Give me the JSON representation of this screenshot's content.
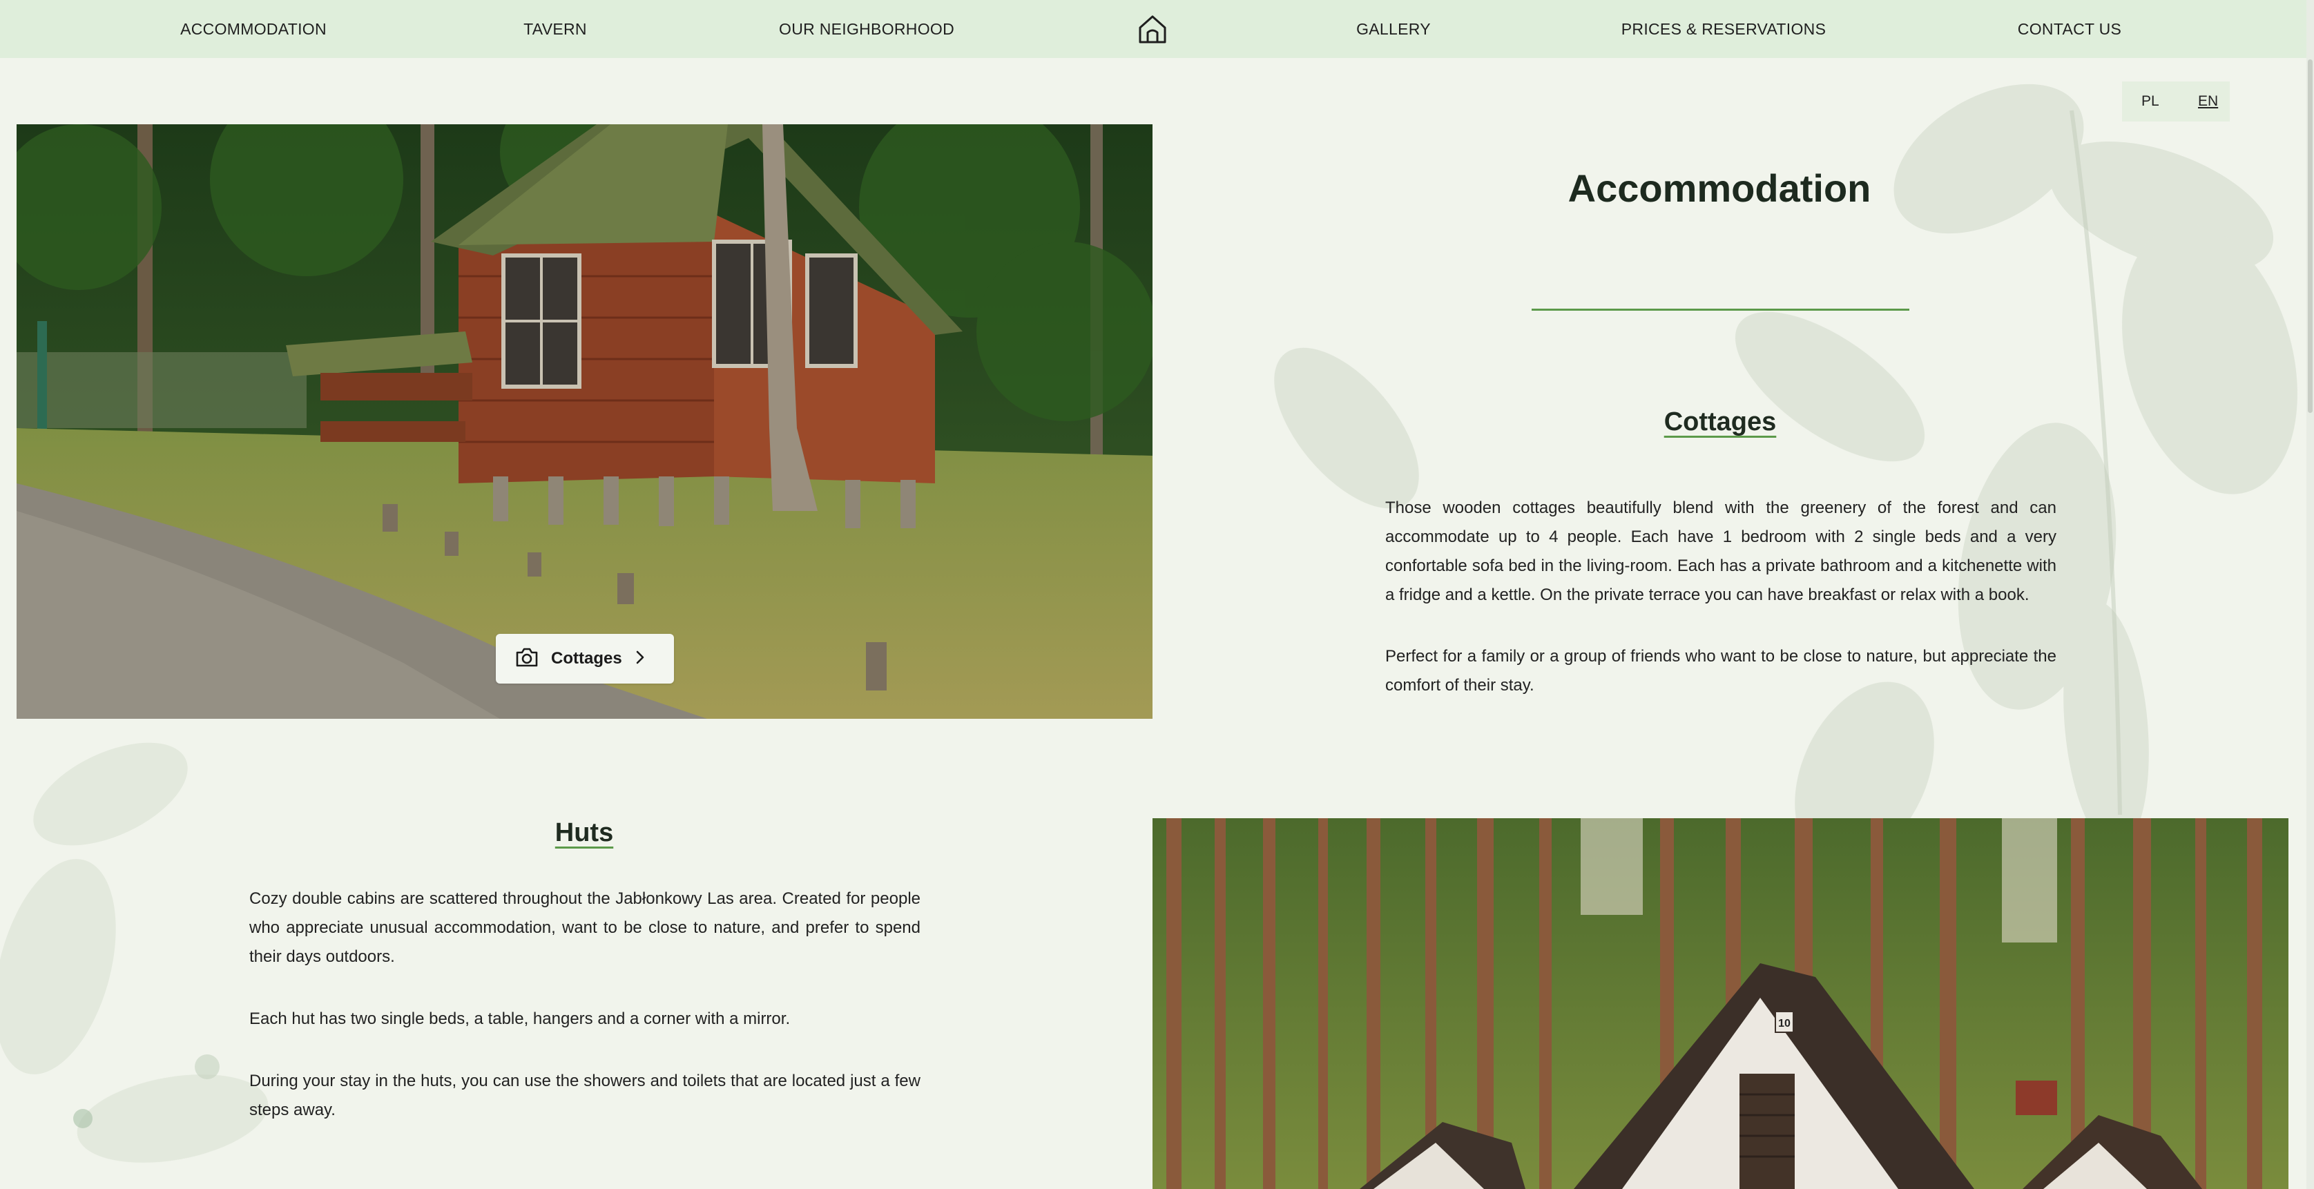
{
  "nav": {
    "items": [
      {
        "label": "ACCOMMODATION"
      },
      {
        "label": "TAVERN"
      },
      {
        "label": "OUR NEIGHBORHOOD"
      },
      {
        "label": "GALLERY"
      },
      {
        "label": "PRICES & RESERVATIONS"
      },
      {
        "label": "CONTACT US"
      }
    ],
    "home_icon": "home-icon"
  },
  "lang": {
    "pl": "PL",
    "en": "EN",
    "active": "EN"
  },
  "accommodation": {
    "title": "Accommodation",
    "cottages": {
      "heading": "Cottages",
      "gallery_button": "Cottages",
      "paragraphs": [
        "Those wooden cottages beautifully blend with the greenery of the forest and can accommodate up to 4 people. Each have 1 bedroom with 2 single beds and a very confortable sofa bed in the living-room. Each has a private bathroom and a kitchenette with a fridge and a kettle. On the private terrace you can have breakfast or relax with a book.",
        "Perfect for a family or a group of friends who want to be close to nature, but appreciate the comfort of their stay."
      ]
    },
    "huts": {
      "heading": "Huts",
      "sign_number": "10",
      "paragraphs": [
        "Cozy double cabins are scattered throughout the Jabłonkowy Las area. Created for people who appreciate unusual accommodation, want to be close to nature, and prefer to spend their days outdoors.",
        "Each hut has two single beds, a table, hangers and a corner with a mirror.",
        "During your stay in the huts, you can use the showers and toilets that are located just a few steps away."
      ]
    }
  },
  "colors": {
    "nav_bg": "#dfeedb",
    "page_bg": "#f1f4ec",
    "accent_green": "#5c9a4a",
    "heading_dark": "#1d2a1f"
  },
  "icons": [
    "home-icon",
    "camera-icon",
    "chevron-right-icon"
  ]
}
